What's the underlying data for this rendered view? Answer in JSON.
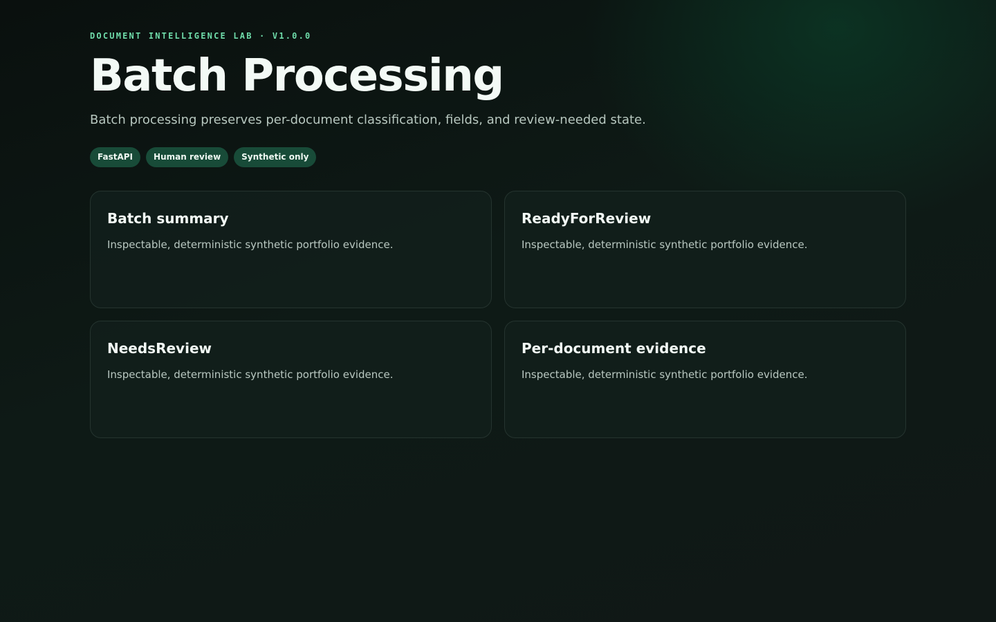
{
  "header": {
    "eyebrow": "DOCUMENT INTELLIGENCE LAB · V1.0.0",
    "title": "Batch Processing",
    "subtitle": "Batch processing preserves per-document classification, fields, and review-needed state."
  },
  "tags": [
    "FastAPI",
    "Human review",
    "Synthetic only"
  ],
  "cards": [
    {
      "title": "Batch summary",
      "text": "Inspectable, deterministic synthetic portfolio evidence."
    },
    {
      "title": "ReadyForReview",
      "text": "Inspectable, deterministic synthetic portfolio evidence."
    },
    {
      "title": "NeedsReview",
      "text": "Inspectable, deterministic synthetic portfolio evidence."
    },
    {
      "title": "Per-document evidence",
      "text": "Inspectable, deterministic synthetic portfolio evidence."
    }
  ],
  "colors": {
    "accent": "#6fdcaa",
    "tag_background": "#184b38",
    "card_background": "#111e1b"
  }
}
